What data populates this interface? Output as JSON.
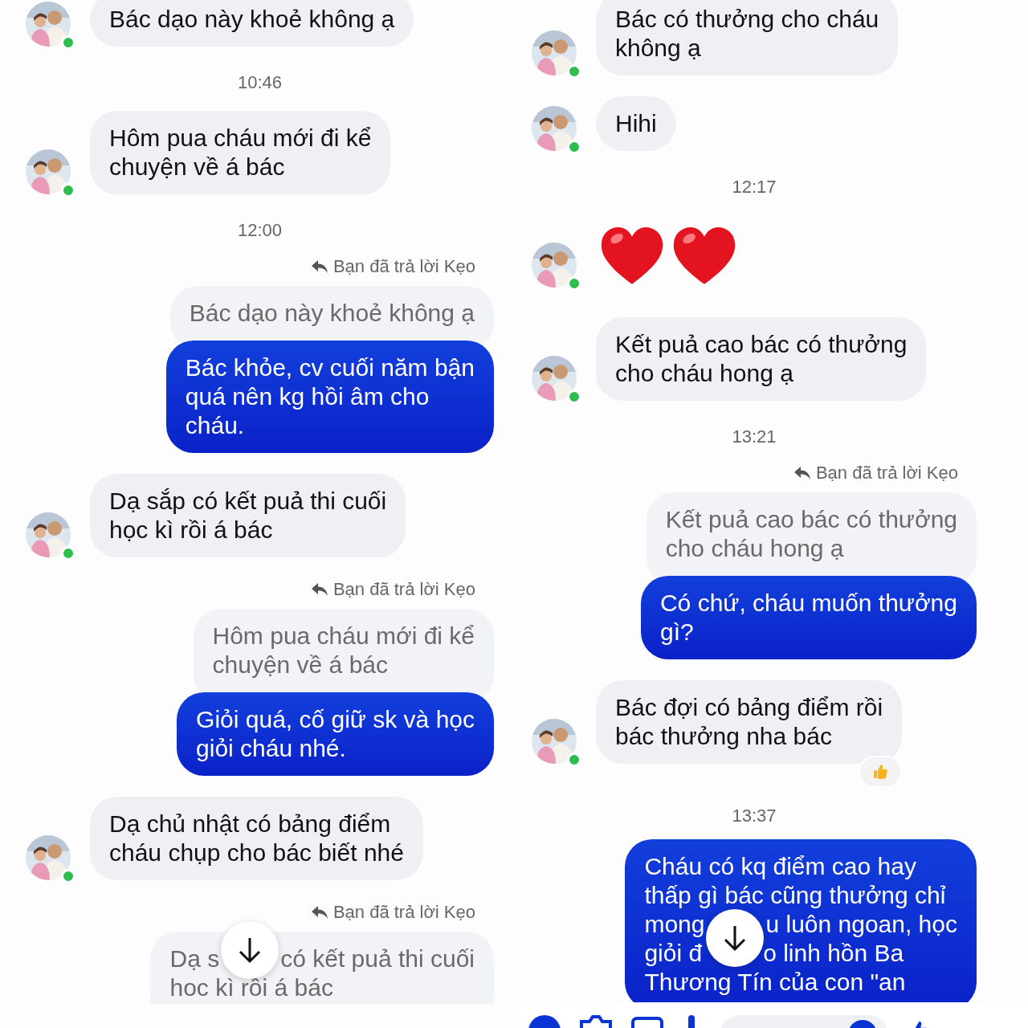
{
  "columns": [
    {
      "scroll_button": true,
      "items": [
        {
          "kind": "incoming",
          "online": true,
          "lines": [
            "Bác dạo này khoẻ không ạ"
          ]
        },
        {
          "kind": "time",
          "text": "10:46"
        },
        {
          "kind": "incoming",
          "online": true,
          "lines": [
            "Hôm pua cháu mới đi kể",
            "chuyện về á bác"
          ]
        },
        {
          "kind": "time",
          "text": "12:00"
        },
        {
          "kind": "reply_note",
          "text": "Bạn đã trả lời Kẹo"
        },
        {
          "kind": "quoted",
          "lines": [
            "Bác dạo này khoẻ không ạ"
          ]
        },
        {
          "kind": "outgoing",
          "lines": [
            "Bác khỏe, cv cuối năm bận",
            "quá nên kg hồi âm cho",
            "cháu."
          ]
        },
        {
          "kind": "incoming",
          "online": true,
          "lines": [
            "Dạ sắp có kết puả thi cuối",
            "học kì rồi á bác"
          ]
        },
        {
          "kind": "reply_note",
          "text": "Bạn đã trả lời Kẹo"
        },
        {
          "kind": "quoted",
          "lines": [
            "Hôm pua cháu mới đi kể",
            "chuyện về á bác"
          ]
        },
        {
          "kind": "outgoing",
          "lines": [
            "Giỏi quá, cố giữ sk và học",
            "giỏi cháu nhé."
          ]
        },
        {
          "kind": "incoming",
          "online": true,
          "lines": [
            "Dạ chủ nhật có bảng điểm",
            "cháu chụp cho bác biết nhé"
          ]
        },
        {
          "kind": "reply_note",
          "text": "Bạn đã trả lời Kẹo"
        },
        {
          "kind": "quoted",
          "lines": [
            [
              "Dạ s",
              "có kết puả thi cuối"
            ],
            [
              "hoc kì rồi á bác"
            ]
          ]
        }
      ]
    },
    {
      "scroll_button": true,
      "composer": true,
      "items": [
        {
          "kind": "incoming",
          "online": true,
          "lines": [
            "Bác có thưởng cho cháu",
            "không ạ"
          ]
        },
        {
          "kind": "incoming",
          "online": true,
          "lines": [
            "Hihi"
          ]
        },
        {
          "kind": "time",
          "text": "12:17"
        },
        {
          "kind": "hearts",
          "online": true
        },
        {
          "kind": "incoming",
          "online": true,
          "lines": [
            "Kết puả cao bác có thưởng",
            "cho cháu hong ạ"
          ]
        },
        {
          "kind": "time",
          "text": "13:21"
        },
        {
          "kind": "reply_note",
          "text": "Bạn đã trả lời Kẹo"
        },
        {
          "kind": "quoted",
          "lines": [
            "Kết puả cao bác có thưởng",
            "cho cháu hong ạ"
          ]
        },
        {
          "kind": "outgoing",
          "lines": [
            "Có chứ, cháu muốn thưởng",
            "gì?"
          ]
        },
        {
          "kind": "incoming",
          "online": true,
          "reaction": true,
          "lines": [
            "Bác đợi có bảng điểm rồi",
            "bác thưởng nha bác"
          ]
        },
        {
          "kind": "time",
          "text": "13:37"
        },
        {
          "kind": "outgoing",
          "lines": [
            "Cháu có kq điểm cao hay",
            "thấp gì bác cũng thưởng chỉ",
            [
              "mong",
              "u luôn ngoan, học"
            ],
            [
              "giỏi đ",
              "o linh hồn Ba"
            ],
            "Thương Tín của con \"an"
          ]
        }
      ]
    }
  ]
}
